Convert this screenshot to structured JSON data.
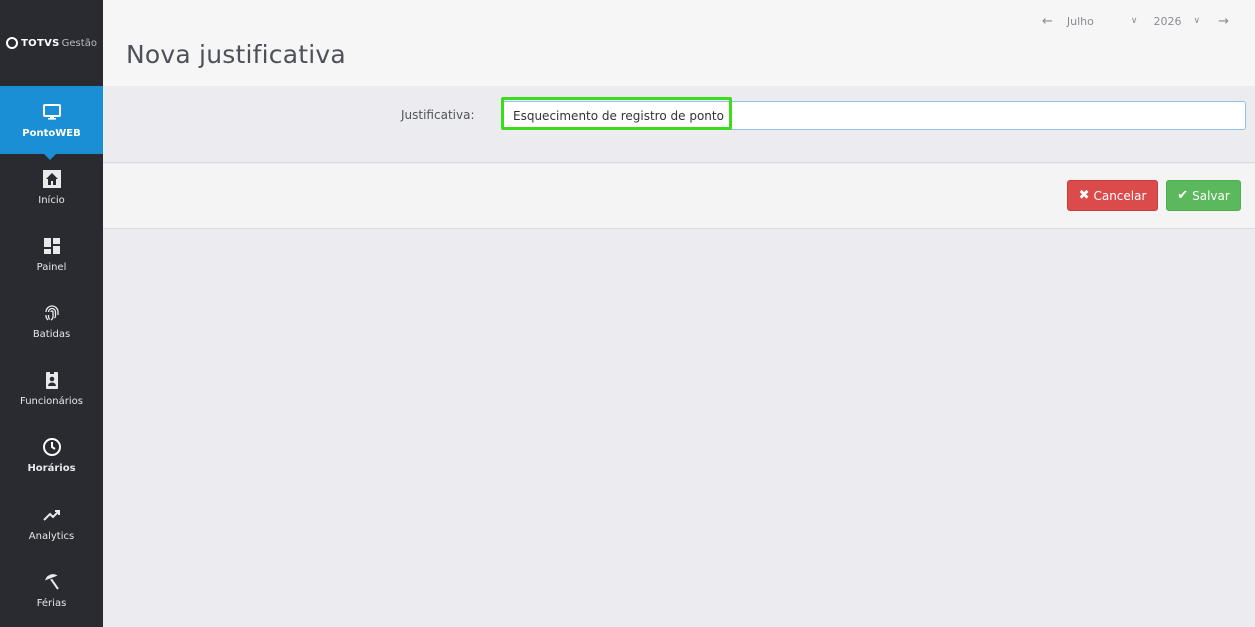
{
  "brand": {
    "name": "TOTVS",
    "product": "Gestão"
  },
  "sidebar": {
    "items": [
      {
        "label": "PontoWEB",
        "icon": "monitor-icon"
      },
      {
        "label": "Início",
        "icon": "home-icon"
      },
      {
        "label": "Painel",
        "icon": "dashboard-icon"
      },
      {
        "label": "Batidas",
        "icon": "fingerprint-icon"
      },
      {
        "label": "Funcionários",
        "icon": "id-badge-icon"
      },
      {
        "label": "Horários",
        "icon": "clock-icon"
      },
      {
        "label": "Analytics",
        "icon": "trend-icon"
      },
      {
        "label": "Férias",
        "icon": "beach-umbrella-icon"
      }
    ]
  },
  "header": {
    "title": "Nova justificativa",
    "period": {
      "month": "Julho",
      "year": "2026"
    }
  },
  "form": {
    "label": "Justificativa:",
    "value": "Esquecimento de registro de ponto"
  },
  "actions": {
    "cancel_label": "Cancelar",
    "save_label": "Salvar"
  },
  "colors": {
    "accent": "#1a8fd6",
    "sidebar": "#2a2b30",
    "danger": "#dc4b4b",
    "success": "#5cb85c",
    "highlight": "#3cdc1c"
  }
}
